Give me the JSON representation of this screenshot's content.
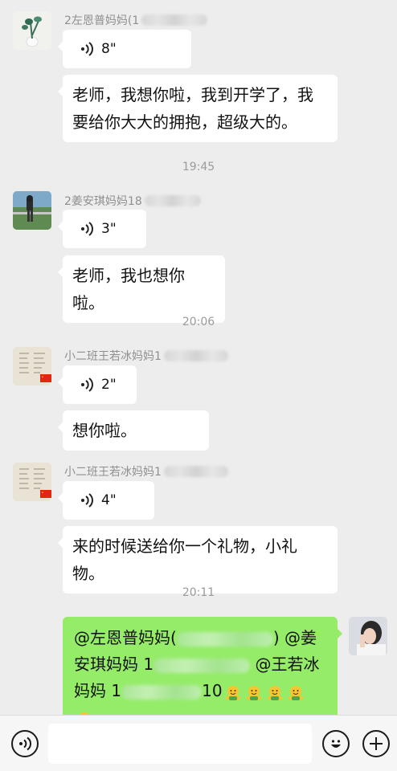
{
  "messages": [
    {
      "sender": "2左恩普妈妈(1",
      "voice": "8\"",
      "text": "老师，我想你啦，我到开学了，我\n要给你大大的拥抱，超级大的。"
    },
    {
      "time": "19:45"
    },
    {
      "sender": "2姜安琪妈妈18",
      "voice": "3\"",
      "text": "老师，我也想你啦。"
    },
    {
      "time": "20:06"
    },
    {
      "sender": "小二班王若冰妈妈1",
      "voice": "2\"",
      "text": "想你啦。"
    },
    {
      "sender": "小二班王若冰妈妈1",
      "voice": "4\"",
      "text": "来的时候送给你一个礼物，小礼物。"
    },
    {
      "time": "20:11"
    }
  ],
  "self_message": {
    "line1_prefix": "@左恩普妈妈(",
    "line1_suffix": ") @姜",
    "line2_prefix": "安琪妈妈 1",
    "line2_suffix": " @王若冰",
    "line3_prefix": "妈妈 1",
    "line3_tail": "10",
    "emoji_count": 5
  },
  "bottom_bar": {
    "voice_icon": "voice-input-icon",
    "emoji_icon": "emoji-icon",
    "plus_icon": "plus-icon"
  },
  "colors": {
    "self_bubble": "#95ec69",
    "background": "#ededed"
  }
}
